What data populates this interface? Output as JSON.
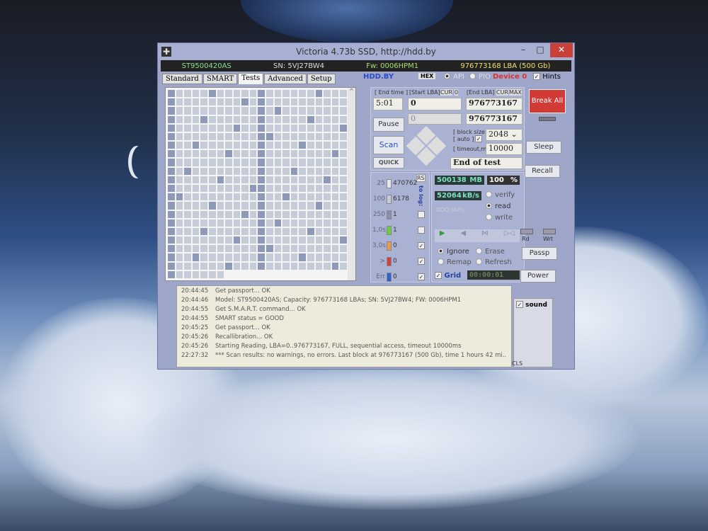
{
  "window": {
    "title": "Victoria 4.73b SSD, http://hdd.by",
    "minimize": "–",
    "maximize": "□",
    "close": "✕"
  },
  "info": {
    "model": "ST9500420AS",
    "serial": "SN: 5VJ27BW4",
    "firmware": "Fw: 0006HPM1",
    "capacity": "976773168 LBA (500 Gb)"
  },
  "tabs": [
    {
      "label": "Standard"
    },
    {
      "label": "SMART"
    },
    {
      "label": "Tests",
      "active": true
    },
    {
      "label": "Advanced"
    },
    {
      "label": "Setup"
    }
  ],
  "toolbar": {
    "site": "HDD.BY",
    "hex": "HEX",
    "api": "API",
    "pio": "PIO",
    "device": "Device 0",
    "hints": "Hints",
    "hints_checked": true
  },
  "test": {
    "end_time_label": "[ End time ]",
    "end_time": "5:01",
    "start_lba_label": "[Start LBA]",
    "clr": "CUR",
    "zero": "0",
    "end_lba_label": "[End LBA]",
    "cur": "CUR",
    "max": "MAX",
    "start_lba": "0",
    "end_lba": "976773167",
    "cur_lba": "0",
    "cur_end_lba": "976773167",
    "pause": "Pause",
    "scan": "Scan",
    "quick": "QUICK",
    "block_size_label": "[ block size ]",
    "auto_label": "[ auto ]",
    "block_size": "2048",
    "timeout_label": "[ timeout,ms ]",
    "timeout": "10000",
    "end_action": "End of test"
  },
  "side": {
    "break_all": "Break All",
    "sleep": "Sleep",
    "recall": "Recall",
    "rd": "Rd",
    "wrt": "Wrt",
    "passp": "Passp",
    "power": "Power"
  },
  "stats": {
    "rs": "RS",
    "to_log": "to log:",
    "rows": [
      {
        "label": "25",
        "count": "470762",
        "color": "#e8e8e8",
        "log": null
      },
      {
        "label": "100",
        "count": "6178",
        "color": "#c8ccd6",
        "log": null
      },
      {
        "label": "250",
        "count": "1",
        "color": "#8890a8",
        "log": false
      },
      {
        "label": "1,0s",
        "count": "1",
        "color": "#6ccc44",
        "log": false
      },
      {
        "label": "3,0s",
        "count": "0",
        "color": "#e89a50",
        "log": true
      },
      {
        "label": ">",
        "count": "0",
        "color": "#d04040",
        "log": true
      },
      {
        "label": "Err",
        "count": "0",
        "color": "#3060d0",
        "log": true
      }
    ]
  },
  "progress": {
    "mb": "500138",
    "mb_unit": "MB",
    "percent": "100",
    "percent_unit": "%",
    "speed": "52064",
    "speed_unit": "kB/s",
    "ddd": "DDD (API)",
    "mode_verify": "verify",
    "mode_read": "read",
    "mode_write": "write",
    "selected_mode": "read"
  },
  "actions": {
    "ignore": "Ignore",
    "erase": "Erase",
    "remap": "Remap",
    "refresh": "Refresh",
    "selected": "Ignore",
    "grid": "Grid",
    "grid_checked": true,
    "timer": "00:00:01"
  },
  "log": [
    {
      "time": "20:44:45",
      "text": "Get passport... OK"
    },
    {
      "time": "20:44:46",
      "text": "Model: ST9500420AS; Capacity: 976773168 LBAs; SN: 5VJ27BW4; FW: 0006HPM1"
    },
    {
      "time": "20:44:55",
      "text": "Get S.M.A.R.T. command... OK"
    },
    {
      "time": "20:44:55",
      "text": "SMART status = GOOD"
    },
    {
      "time": "20:45:25",
      "text": "Get passport... OK"
    },
    {
      "time": "20:45:26",
      "text": "Recallibration... OK"
    },
    {
      "time": "20:45:26",
      "text": "Starting Reading, LBA=0..976773167, FULL, sequential access, timeout 10000ms"
    },
    {
      "time": "22:27:32",
      "text": "*** Scan results: no warnings, no errors. Last block at 976773167 (500 Gb), time 1 hours 42 mi..."
    }
  ],
  "sound": {
    "label": "sound",
    "checked": true,
    "cls": "CLS"
  }
}
